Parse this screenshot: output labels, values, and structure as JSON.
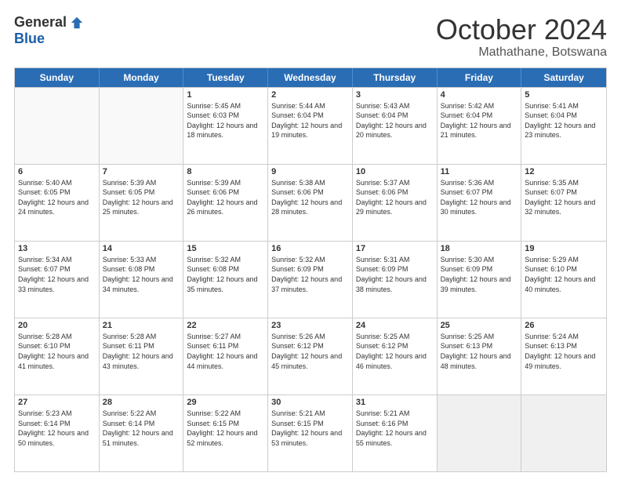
{
  "logo": {
    "general": "General",
    "blue": "Blue"
  },
  "header": {
    "month": "October 2024",
    "location": "Mathathane, Botswana"
  },
  "days": [
    "Sunday",
    "Monday",
    "Tuesday",
    "Wednesday",
    "Thursday",
    "Friday",
    "Saturday"
  ],
  "weeks": [
    [
      {
        "day": "",
        "sunrise": "",
        "sunset": "",
        "daylight": ""
      },
      {
        "day": "",
        "sunrise": "",
        "sunset": "",
        "daylight": ""
      },
      {
        "day": "1",
        "sunrise": "Sunrise: 5:45 AM",
        "sunset": "Sunset: 6:03 PM",
        "daylight": "Daylight: 12 hours and 18 minutes."
      },
      {
        "day": "2",
        "sunrise": "Sunrise: 5:44 AM",
        "sunset": "Sunset: 6:04 PM",
        "daylight": "Daylight: 12 hours and 19 minutes."
      },
      {
        "day": "3",
        "sunrise": "Sunrise: 5:43 AM",
        "sunset": "Sunset: 6:04 PM",
        "daylight": "Daylight: 12 hours and 20 minutes."
      },
      {
        "day": "4",
        "sunrise": "Sunrise: 5:42 AM",
        "sunset": "Sunset: 6:04 PM",
        "daylight": "Daylight: 12 hours and 21 minutes."
      },
      {
        "day": "5",
        "sunrise": "Sunrise: 5:41 AM",
        "sunset": "Sunset: 6:04 PM",
        "daylight": "Daylight: 12 hours and 23 minutes."
      }
    ],
    [
      {
        "day": "6",
        "sunrise": "Sunrise: 5:40 AM",
        "sunset": "Sunset: 6:05 PM",
        "daylight": "Daylight: 12 hours and 24 minutes."
      },
      {
        "day": "7",
        "sunrise": "Sunrise: 5:39 AM",
        "sunset": "Sunset: 6:05 PM",
        "daylight": "Daylight: 12 hours and 25 minutes."
      },
      {
        "day": "8",
        "sunrise": "Sunrise: 5:39 AM",
        "sunset": "Sunset: 6:06 PM",
        "daylight": "Daylight: 12 hours and 26 minutes."
      },
      {
        "day": "9",
        "sunrise": "Sunrise: 5:38 AM",
        "sunset": "Sunset: 6:06 PM",
        "daylight": "Daylight: 12 hours and 28 minutes."
      },
      {
        "day": "10",
        "sunrise": "Sunrise: 5:37 AM",
        "sunset": "Sunset: 6:06 PM",
        "daylight": "Daylight: 12 hours and 29 minutes."
      },
      {
        "day": "11",
        "sunrise": "Sunrise: 5:36 AM",
        "sunset": "Sunset: 6:07 PM",
        "daylight": "Daylight: 12 hours and 30 minutes."
      },
      {
        "day": "12",
        "sunrise": "Sunrise: 5:35 AM",
        "sunset": "Sunset: 6:07 PM",
        "daylight": "Daylight: 12 hours and 32 minutes."
      }
    ],
    [
      {
        "day": "13",
        "sunrise": "Sunrise: 5:34 AM",
        "sunset": "Sunset: 6:07 PM",
        "daylight": "Daylight: 12 hours and 33 minutes."
      },
      {
        "day": "14",
        "sunrise": "Sunrise: 5:33 AM",
        "sunset": "Sunset: 6:08 PM",
        "daylight": "Daylight: 12 hours and 34 minutes."
      },
      {
        "day": "15",
        "sunrise": "Sunrise: 5:32 AM",
        "sunset": "Sunset: 6:08 PM",
        "daylight": "Daylight: 12 hours and 35 minutes."
      },
      {
        "day": "16",
        "sunrise": "Sunrise: 5:32 AM",
        "sunset": "Sunset: 6:09 PM",
        "daylight": "Daylight: 12 hours and 37 minutes."
      },
      {
        "day": "17",
        "sunrise": "Sunrise: 5:31 AM",
        "sunset": "Sunset: 6:09 PM",
        "daylight": "Daylight: 12 hours and 38 minutes."
      },
      {
        "day": "18",
        "sunrise": "Sunrise: 5:30 AM",
        "sunset": "Sunset: 6:09 PM",
        "daylight": "Daylight: 12 hours and 39 minutes."
      },
      {
        "day": "19",
        "sunrise": "Sunrise: 5:29 AM",
        "sunset": "Sunset: 6:10 PM",
        "daylight": "Daylight: 12 hours and 40 minutes."
      }
    ],
    [
      {
        "day": "20",
        "sunrise": "Sunrise: 5:28 AM",
        "sunset": "Sunset: 6:10 PM",
        "daylight": "Daylight: 12 hours and 41 minutes."
      },
      {
        "day": "21",
        "sunrise": "Sunrise: 5:28 AM",
        "sunset": "Sunset: 6:11 PM",
        "daylight": "Daylight: 12 hours and 43 minutes."
      },
      {
        "day": "22",
        "sunrise": "Sunrise: 5:27 AM",
        "sunset": "Sunset: 6:11 PM",
        "daylight": "Daylight: 12 hours and 44 minutes."
      },
      {
        "day": "23",
        "sunrise": "Sunrise: 5:26 AM",
        "sunset": "Sunset: 6:12 PM",
        "daylight": "Daylight: 12 hours and 45 minutes."
      },
      {
        "day": "24",
        "sunrise": "Sunrise: 5:25 AM",
        "sunset": "Sunset: 6:12 PM",
        "daylight": "Daylight: 12 hours and 46 minutes."
      },
      {
        "day": "25",
        "sunrise": "Sunrise: 5:25 AM",
        "sunset": "Sunset: 6:13 PM",
        "daylight": "Daylight: 12 hours and 48 minutes."
      },
      {
        "day": "26",
        "sunrise": "Sunrise: 5:24 AM",
        "sunset": "Sunset: 6:13 PM",
        "daylight": "Daylight: 12 hours and 49 minutes."
      }
    ],
    [
      {
        "day": "27",
        "sunrise": "Sunrise: 5:23 AM",
        "sunset": "Sunset: 6:14 PM",
        "daylight": "Daylight: 12 hours and 50 minutes."
      },
      {
        "day": "28",
        "sunrise": "Sunrise: 5:22 AM",
        "sunset": "Sunset: 6:14 PM",
        "daylight": "Daylight: 12 hours and 51 minutes."
      },
      {
        "day": "29",
        "sunrise": "Sunrise: 5:22 AM",
        "sunset": "Sunset: 6:15 PM",
        "daylight": "Daylight: 12 hours and 52 minutes."
      },
      {
        "day": "30",
        "sunrise": "Sunrise: 5:21 AM",
        "sunset": "Sunset: 6:15 PM",
        "daylight": "Daylight: 12 hours and 53 minutes."
      },
      {
        "day": "31",
        "sunrise": "Sunrise: 5:21 AM",
        "sunset": "Sunset: 6:16 PM",
        "daylight": "Daylight: 12 hours and 55 minutes."
      },
      {
        "day": "",
        "sunrise": "",
        "sunset": "",
        "daylight": ""
      },
      {
        "day": "",
        "sunrise": "",
        "sunset": "",
        "daylight": ""
      }
    ]
  ]
}
